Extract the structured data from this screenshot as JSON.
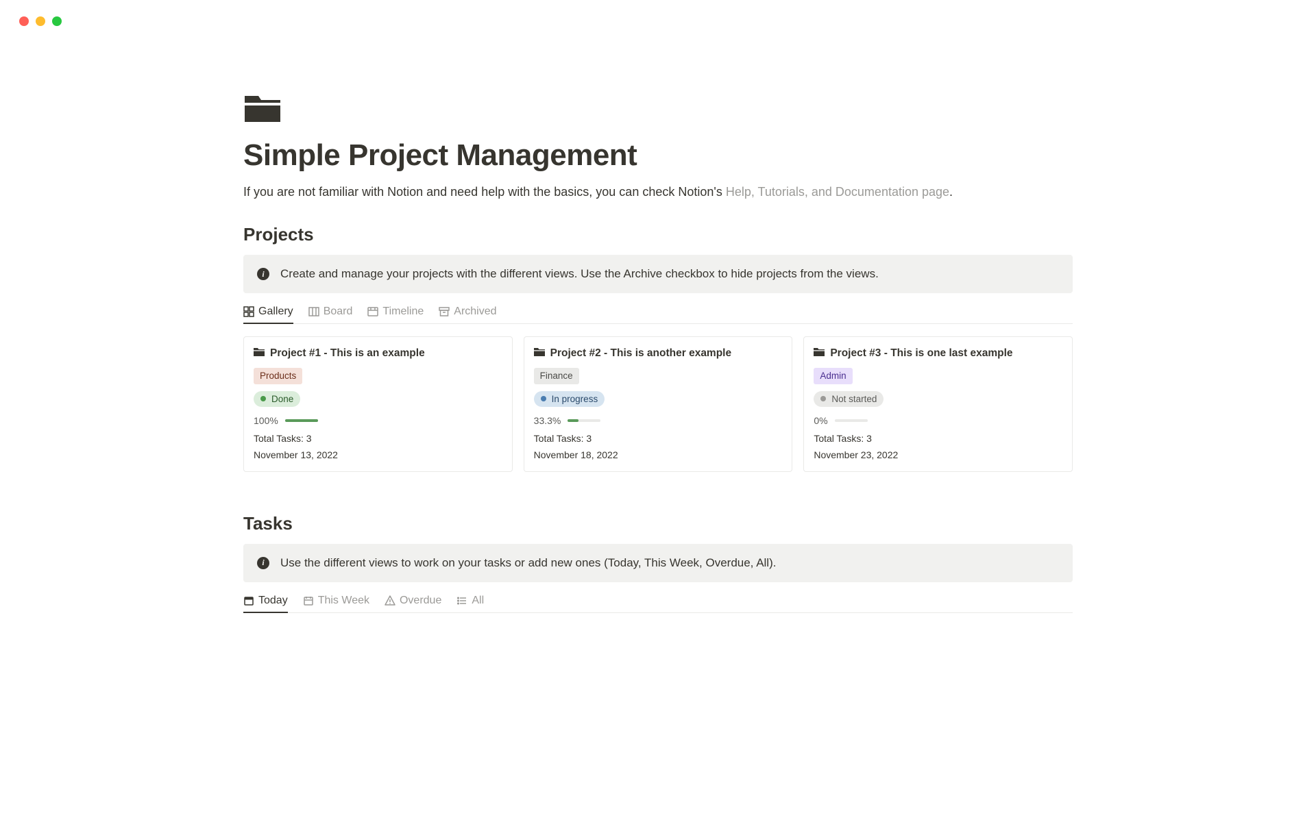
{
  "page": {
    "title": "Simple Project Management",
    "subtitle_prefix": "If you are not familiar with Notion and need help with the basics, you can check Notion's ",
    "subtitle_link": "Help, Tutorials, and Documentation page",
    "subtitle_suffix": "."
  },
  "projects": {
    "heading": "Projects",
    "callout": "Create and manage your projects with the different views. Use the Archive checkbox to hide projects from the views.",
    "tabs": [
      {
        "label": "Gallery",
        "active": true
      },
      {
        "label": "Board",
        "active": false
      },
      {
        "label": "Timeline",
        "active": false
      },
      {
        "label": "Archived",
        "active": false
      }
    ],
    "cards": [
      {
        "title": "Project #1 - This is an example",
        "tag": "Products",
        "tag_class": "products",
        "status": "Done",
        "status_class": "done",
        "percent": "100%",
        "percent_num": 100,
        "total": "Total Tasks: 3",
        "date": "November 13, 2022"
      },
      {
        "title": "Project #2 - This is another example",
        "tag": "Finance",
        "tag_class": "finance",
        "status": "In progress",
        "status_class": "progress",
        "percent": "33.3%",
        "percent_num": 33.3,
        "total": "Total Tasks: 3",
        "date": "November 18, 2022"
      },
      {
        "title": "Project #3 - This is one last example",
        "tag": "Admin",
        "tag_class": "admin",
        "status": "Not started",
        "status_class": "notstarted",
        "percent": "0%",
        "percent_num": 0,
        "total": "Total Tasks: 3",
        "date": "November 23, 2022"
      }
    ]
  },
  "tasks": {
    "heading": "Tasks",
    "callout": "Use the different views to work on your tasks or add new ones (Today, This Week, Overdue, All).",
    "tabs": [
      {
        "label": "Today",
        "active": true
      },
      {
        "label": "This Week",
        "active": false
      },
      {
        "label": "Overdue",
        "active": false
      },
      {
        "label": "All",
        "active": false
      }
    ]
  }
}
